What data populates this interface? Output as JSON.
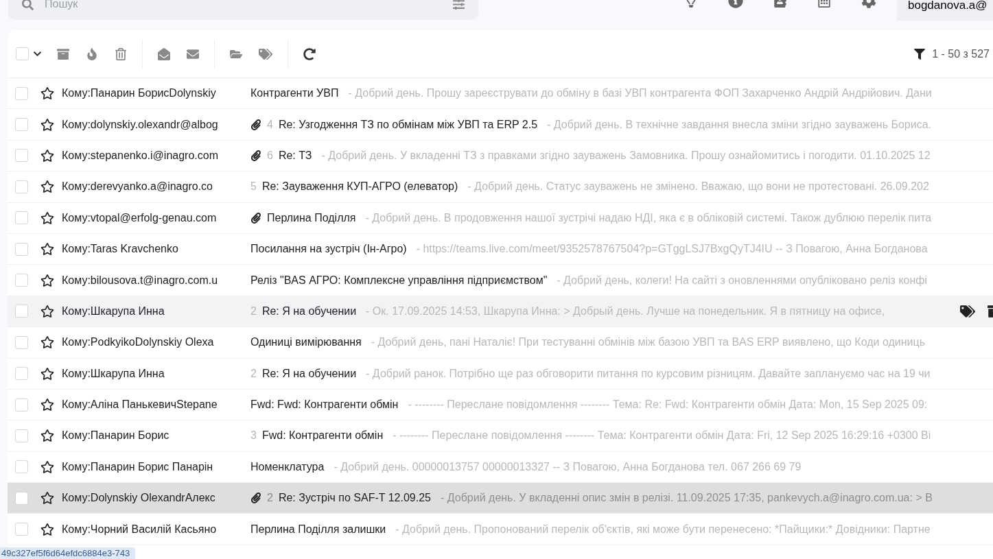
{
  "header": {
    "search": {
      "placeholder": "Пошук"
    },
    "account": "bogdanova.a@"
  },
  "toolbar": {
    "select_all_checked": false,
    "range": "1 - 50 з 527"
  },
  "rows": [
    {
      "to": "Кому:Панарин БорисDolynskiy",
      "attachment": false,
      "subject": "Контрагенти УВП",
      "snippet": "- Добрий день. Прошу зареєструвати до обміну в базі УВП контрагента ФОП Захарченко Андрій Андрійович. Дани",
      "selected": false,
      "hovered": false
    },
    {
      "to": "Кому:dolynskiy.olexandr@albog",
      "attachment": true,
      "count": "4",
      "subject": "Re: Узгодження ТЗ по обмінам між УВП та ERP 2.5",
      "snippet": "- Добрий день. В технічне завдання внесла зміни згідно зауважень Бориса.",
      "selected": false,
      "hovered": false
    },
    {
      "to": "Кому:stepanenko.i@inagro.com",
      "attachment": true,
      "count": "6",
      "subject": "Re: ТЗ",
      "snippet": "- Добрий день. У вкладенні ТЗ з правками згідно зауважень Замовника. Прошу ознайомитись і погодити. 01.10.2025 12",
      "selected": false,
      "hovered": false
    },
    {
      "to": "Кому:derevyanko.a@inagro.co",
      "attachment": false,
      "count": "5",
      "subject": "Re: Зауваження КУП-АГРО (елеватор)",
      "snippet": "- Добрий день. Статус зауважень не змінено. Вважаю, що вони не протестовані. 26.09.202",
      "selected": false,
      "hovered": false
    },
    {
      "to": "Кому:vtopal@erfolg-genau.com",
      "attachment": true,
      "subject": "Перлина Поділля",
      "snippet": "- Добрий день. В продовження нашої зустрічі надаю НДІ, яка є в обліковій системі. Також дублюю перелік пита",
      "selected": false,
      "hovered": false
    },
    {
      "to": "Кому:Taras Kravchenko",
      "attachment": false,
      "subject": "Посилання на зустріч (Ін-Агро)",
      "snippet": "- https://teams.live.com/meet/9352578767504?p=GTggLSJ7BxgQyTJ4IU -- З Повагою, Анна Богданова",
      "selected": false,
      "hovered": false
    },
    {
      "to": "Кому:bilousova.t@inagro.com.u",
      "attachment": false,
      "subject": "Реліз \"BAS АГРО: Комплексне управління підприємством\"",
      "snippet": "- Добрий день, колеги! На сайті з оновленнями опубліковано реліз конфі",
      "selected": false,
      "hovered": false
    },
    {
      "to": "Кому:Шкарупа Инна",
      "attachment": false,
      "count": "2",
      "subject": "Re: Я на обучении",
      "snippet": "- Ок. 17.09.2025 14:53, Шкарупа Инна: > Добрый день. Лучше на понедельник. Я в пятницу на офисе,",
      "selected": false,
      "hovered": true
    },
    {
      "to": "Кому:PodkyikoDolynskiy Olexa",
      "attachment": false,
      "subject": "Одиниці вимірювання",
      "snippet": "- Добрий день, пані Наталіє! При тестуванні обмінів між базою УВП та BAS ERP виявлено, що Коди одиниць",
      "selected": false,
      "hovered": false
    },
    {
      "to": "Кому:Шкарупа Инна",
      "attachment": false,
      "count": "2",
      "subject": "Re: Я на обучении",
      "snippet": "- Добрий ранок. Потрібно ще раз обговорити питання по курсовим різницям. Давайте заплануємо час на 19 чи",
      "selected": false,
      "hovered": false
    },
    {
      "to": "Кому:Аліна ПанькевичStepane",
      "attachment": false,
      "subject": "Fwd: Fwd: Контрагенти обмін",
      "snippet": "- -------- Переслане повідомлення -------- Тема: Re: Fwd: Контрагенти обмін Дата: Mon, 15 Sep 2025 09:",
      "selected": false,
      "hovered": false
    },
    {
      "to": "Кому:Панарин Борис",
      "attachment": false,
      "count": "3",
      "subject": "Fwd: Контрагенти обмін",
      "snippet": "- -------- Переслане повідомлення -------- Тема: Контрагенти обмін Дата: Fri, 12 Sep 2025 16:29:16 +0300 Ві",
      "selected": false,
      "hovered": false
    },
    {
      "to": "Кому:Панарин Борис Панарін",
      "attachment": false,
      "subject": "Номенклатура",
      "snippet": "- Добрий день. 00000013757 00000013327 -- З Повагою, Анна Богданова тел. 067 266 69 79",
      "selected": false,
      "hovered": false
    },
    {
      "to": "Кому:Dolynskiy OlexandrАлекс",
      "attachment": true,
      "count": "2",
      "subject": "Re: Зустріч по SAF-T 12.09.25",
      "snippet": "- Добрий день. У вкладенні опис змін в релізі. 11.09.2025 17:35, pankevych.a@inagro.com.ua: > В",
      "selected": true,
      "hovered": false
    },
    {
      "to": "Кому:Чорний Василій Касьяно",
      "attachment": false,
      "subject": "Перлина Поділля залишки",
      "snippet": "- Добрий день. Пропонований перелік об'єктів, які може бути перенесено: *Пайщики:* Довідники: Партне",
      "selected": false,
      "hovered": false
    }
  ],
  "status_link": "49c327ef5f6d64efdc6884e3-743"
}
